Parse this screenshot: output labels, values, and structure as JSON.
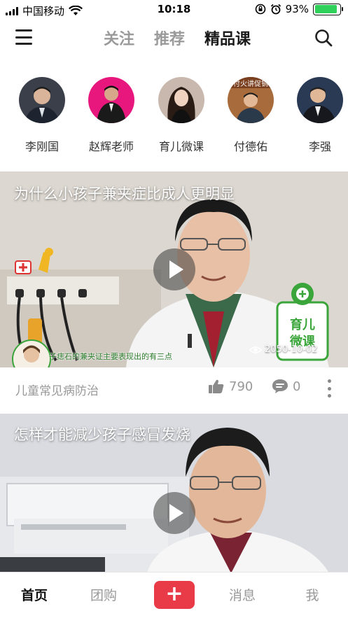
{
  "status_bar": {
    "carrier": "中国移动",
    "time": "10:18",
    "battery": "93%",
    "battery_color": "#2fd15b"
  },
  "top_nav": {
    "tabs": [
      {
        "label": "关注",
        "active": false
      },
      {
        "label": "推荐",
        "active": false
      },
      {
        "label": "精品课",
        "active": true
      }
    ]
  },
  "teachers": [
    {
      "name": "李刚国",
      "avatar_bg": "#3a3f4a"
    },
    {
      "name": "赵辉老师",
      "avatar_bg": "#e8177d"
    },
    {
      "name": "育儿微课",
      "avatar_bg": "#4a3a33"
    },
    {
      "name": "付德佑",
      "avatar_bg": "#a86b3c",
      "banner_text": "付火讲促销"
    },
    {
      "name": "李强",
      "avatar_bg": "#2a3a55"
    }
  ],
  "videos": [
    {
      "title": "为什么小孩子兼夹症比成人更明显",
      "subtitle_overlay": "子痣石的兼夹证主要表现出的有三点",
      "date_overlay": "2050-10-02",
      "watermark": "育儿微课",
      "category": "儿童常见病防治",
      "likes": "790",
      "comments": "0"
    },
    {
      "title": "怎样才能减少孩子感冒发烧"
    }
  ],
  "bottom_bar": {
    "home": "首页",
    "group_buy": "团购",
    "add": "+",
    "messages": "消息",
    "me": "我"
  },
  "colors": {
    "accent": "#e83a47",
    "watermark_green": "#3aa53a"
  }
}
